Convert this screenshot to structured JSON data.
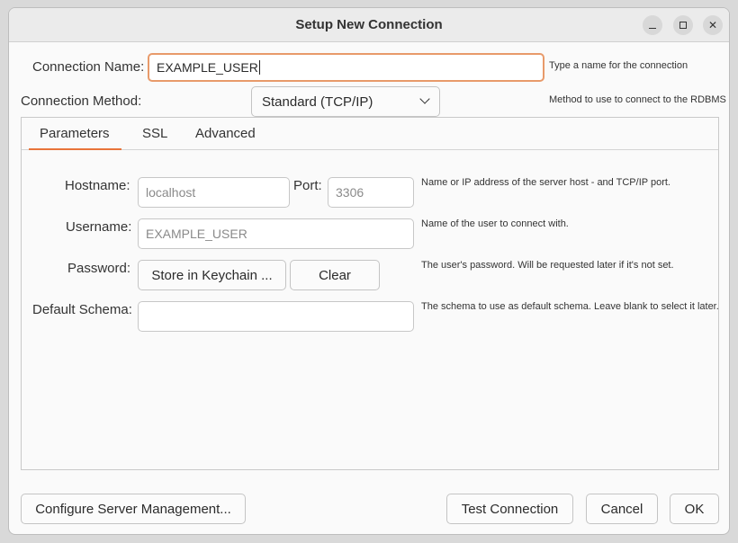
{
  "window": {
    "title": "Setup New Connection"
  },
  "connection": {
    "name_label": "Connection Name:",
    "name_value": "EXAMPLE_USER",
    "name_hint": "Type a name for the connection",
    "method_label": "Connection Method:",
    "method_value": "Standard (TCP/IP)",
    "method_hint": "Method to use to connect to the RDBMS"
  },
  "tabs": [
    {
      "label": "Parameters"
    },
    {
      "label": "SSL"
    },
    {
      "label": "Advanced"
    }
  ],
  "params": {
    "hostname_label": "Hostname:",
    "hostname_value": "localhost",
    "port_label": "Port:",
    "port_value": "3306",
    "hostname_hint": "Name or IP address of the server host - and TCP/IP port.",
    "username_label": "Username:",
    "username_value": "EXAMPLE_USER",
    "username_hint": "Name of the user to connect with.",
    "password_label": "Password:",
    "store_keychain_label": "Store in Keychain ...",
    "clear_label": "Clear",
    "password_hint": "The user's password. Will be requested later if it's not set.",
    "schema_label": "Default Schema:",
    "schema_value": "",
    "schema_hint": "The schema to use as default schema. Leave blank to select it later."
  },
  "footer": {
    "configure_label": "Configure Server Management...",
    "test_label": "Test Connection",
    "cancel_label": "Cancel",
    "ok_label": "OK"
  }
}
